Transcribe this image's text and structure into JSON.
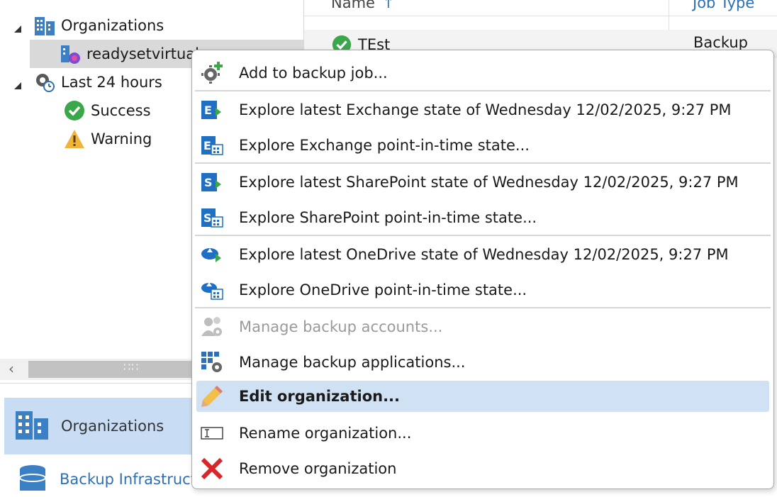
{
  "tree": {
    "organizations_label": "Organizations",
    "org_item_label": "readysetvirtual….",
    "last24_label": "Last 24 hours",
    "success_label": "Success",
    "warning_label": "Warning"
  },
  "nav": {
    "organizations_label": "Organizations",
    "infrastructure_label": "Backup Infrastructure"
  },
  "list": {
    "columns": {
      "name": "Name",
      "name_sort": "↑",
      "job_type": "Job Type"
    },
    "rows": [
      {
        "name": "TEst",
        "job_type": "Backup"
      }
    ]
  },
  "context_menu": {
    "items": [
      {
        "label": "Add to backup job...",
        "icon": "gear-add-icon"
      },
      {
        "label": "Explore latest Exchange state of Wednesday 12/02/2025, 9:27 PM",
        "icon": "exchange-latest-icon"
      },
      {
        "label": "Explore Exchange point-in-time state...",
        "icon": "exchange-pit-icon"
      },
      {
        "label": "Explore latest SharePoint state of Wednesday 12/02/2025, 9:27 PM",
        "icon": "sharepoint-latest-icon"
      },
      {
        "label": "Explore SharePoint point-in-time state...",
        "icon": "sharepoint-pit-icon"
      },
      {
        "label": "Explore latest OneDrive state of Wednesday 12/02/2025, 9:27 PM",
        "icon": "onedrive-latest-icon"
      },
      {
        "label": "Explore OneDrive point-in-time state...",
        "icon": "onedrive-pit-icon"
      },
      {
        "label": "Manage backup accounts...",
        "icon": "accounts-icon",
        "disabled": true
      },
      {
        "label": "Manage backup applications...",
        "icon": "applications-icon"
      },
      {
        "label": "Edit organization...",
        "icon": "pencil-icon",
        "highlighted": true
      },
      {
        "label": "Rename organization...",
        "icon": "rename-icon"
      },
      {
        "label": "Remove organization",
        "icon": "remove-icon"
      }
    ]
  },
  "colors": {
    "accent": "#2f6fb3",
    "highlight": "#cfe1f3",
    "success": "#3aa74a",
    "warning": "#f0b43c",
    "danger": "#d9262b"
  }
}
